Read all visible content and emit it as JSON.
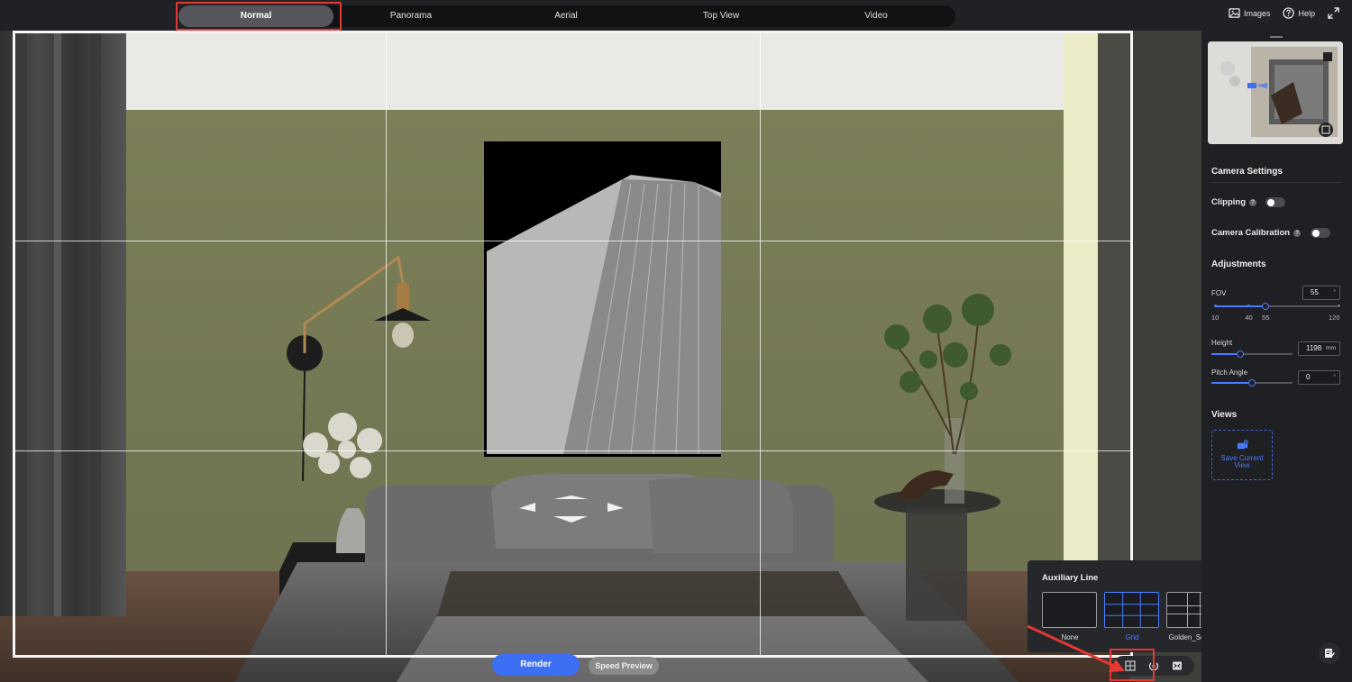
{
  "top_tabs": [
    {
      "label": "Normal",
      "active": true
    },
    {
      "label": "Panorama",
      "active": false
    },
    {
      "label": "Aerial",
      "active": false
    },
    {
      "label": "Top View",
      "active": false
    },
    {
      "label": "Video",
      "active": false
    }
  ],
  "top_actions": {
    "images_label": "Images",
    "help_label": "Help",
    "images_icon": "image-icon",
    "help_icon": "question-circle-icon",
    "fullscreen_icon": "fullscreen-icon"
  },
  "bottom": {
    "render_label": "Render",
    "speed_preview_label": "Speed Preview"
  },
  "auxiliary_line": {
    "title": "Auxiliary Line",
    "options": [
      {
        "label": "None",
        "selected": false
      },
      {
        "label": "Grid",
        "selected": true
      },
      {
        "label": "Golden_Section",
        "selected": false
      }
    ]
  },
  "panel": {
    "camera_settings_title": "Camera Settings",
    "clipping_label": "Clipping",
    "clipping_on": false,
    "camera_calibration_label": "Camera Calibration",
    "camera_calibration_on": false,
    "adjustments_title": "Adjustments",
    "fov": {
      "label": "FOV",
      "value": "55",
      "unit": "°",
      "min": 10,
      "max": 120,
      "current": 55,
      "ticks": [
        "10",
        "40",
        "55",
        "120"
      ]
    },
    "height": {
      "label": "Height",
      "value": "1198",
      "unit": "mm",
      "level": 0.35
    },
    "pitch": {
      "label": "Pitch Angle",
      "value": "0",
      "unit": "°",
      "level": 0.5
    },
    "views_title": "Views",
    "save_view_label": "Save Current View"
  },
  "colors": {
    "accent": "#4a7bff",
    "highlight": "#e53935",
    "render_button": "#3d6ff5"
  }
}
